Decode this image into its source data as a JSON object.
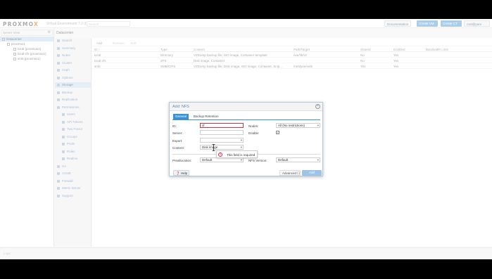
{
  "topbar": {
    "logo_main": "PROXMO",
    "logo_x": "X",
    "version": "Virtual Environment 7.2-3",
    "search_placeholder": "Search",
    "documentation": "Documentation",
    "create_vm": "Create VM",
    "create_ct": "Create CT",
    "user": "root@pam"
  },
  "tree": {
    "view": "Server View",
    "items": [
      {
        "label": "Datacenter"
      },
      {
        "label": "proxmox1"
      },
      {
        "label": "local (proxmox1)"
      },
      {
        "label": "local-zfs (proxmox1)"
      },
      {
        "label": "smb (proxmox1)"
      }
    ]
  },
  "breadcrumb": "Datacenter",
  "nav": [
    {
      "label": "Search"
    },
    {
      "label": "Summary"
    },
    {
      "label": "Notes"
    },
    {
      "label": "Cluster"
    },
    {
      "label": "Ceph"
    },
    {
      "label": "Options"
    },
    {
      "label": "Storage"
    },
    {
      "label": "Backup"
    },
    {
      "label": "Replication"
    },
    {
      "label": "Permissions"
    },
    {
      "label": "Users"
    },
    {
      "label": "API Tokens"
    },
    {
      "label": "Two Factor"
    },
    {
      "label": "Groups"
    },
    {
      "label": "Pools"
    },
    {
      "label": "Roles"
    },
    {
      "label": "Realms"
    },
    {
      "label": "HA"
    },
    {
      "label": "ACME"
    },
    {
      "label": "Firewall"
    },
    {
      "label": "Metric Server"
    },
    {
      "label": "Support"
    }
  ],
  "toolbar": {
    "add": "Add",
    "remove": "Remove",
    "edit": "Edit"
  },
  "grid": {
    "headers": [
      "ID ↑",
      "Type",
      "Content",
      "Path/Target",
      "Shared",
      "Enabled",
      "Bandwidth Limit"
    ],
    "rows": [
      [
        "local",
        "Directory",
        "VZDump backup file, ISO image, Container template",
        "/var/lib/vz",
        "No",
        "Yes",
        ""
      ],
      [
        "local-zfs",
        "ZFS",
        "Disk image, Container",
        "",
        "No",
        "Yes",
        ""
      ],
      [
        "smb",
        "SMB/CIFS",
        "VZDump backup file, Disk image, ISO image, Container, Snip...",
        "/mnt/pve/smb",
        "Yes",
        "Yes",
        ""
      ]
    ]
  },
  "status_text": "Logs",
  "dialog": {
    "title": "Add: NFS",
    "tabs": [
      "General",
      "Backup Retention"
    ],
    "id_label": "ID:",
    "id_value": "sf",
    "server_label": "Server:",
    "export_label": "Export:",
    "content_label": "Content:",
    "content_value": "Disk image",
    "nodes_label": "Nodes:",
    "nodes_value": "All (No restrictions)",
    "enable_label": "Enable:",
    "enable_check": "✓",
    "preallocation_label": "Preallocation:",
    "preallocation_value": "Default",
    "nfs_version_label": "NFS Version:",
    "nfs_version_value": "Default",
    "help": "Help",
    "advanced": "Advanced",
    "add": "Add",
    "tooltip": "This field is required"
  },
  "colors": {
    "accent": "#3892d4",
    "logo_x": "#e57000",
    "link": "#6289b6",
    "error": "#dd2244"
  }
}
